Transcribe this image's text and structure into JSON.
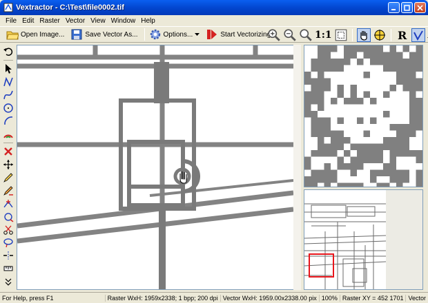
{
  "window": {
    "title": "Vextractor - C:\\Test\\file0002.tif"
  },
  "menu": {
    "items": [
      "File",
      "Edit",
      "Raster",
      "Vector",
      "View",
      "Window",
      "Help"
    ]
  },
  "toolbar": {
    "open_label": "Open Image...",
    "save_label": "Save Vector As...",
    "options_label": "Options...",
    "start_label": "Start Vectorizing",
    "zoom_one_to_one": "1:1",
    "mode_r_label": "R"
  },
  "status": {
    "help": "For Help, press F1",
    "raster": "Raster WxH: 1959x2338; 1 bpp; 200 dpi",
    "vector": "Vector WxH: 1959.00x2338.00 pix",
    "zoom": "100%",
    "raster_xy": "Raster XY =   452 1701",
    "mode": "Vector"
  },
  "colors": {
    "accent": "#0a5ff0",
    "select_box": "#e8151b",
    "raster_gray": "#808080"
  },
  "icons": [
    "app-icon",
    "minimize-icon",
    "maximize-icon",
    "close-icon",
    "open-folder-icon",
    "save-icon",
    "gear-icon",
    "dropdown-icon",
    "start-vectorize-icon",
    "zoom-in-icon",
    "zoom-out-icon",
    "zoom-fit-icon",
    "zoom-window-icon",
    "hand-icon",
    "crosshair-icon",
    "raster-mode-icon",
    "vector-mode-icon"
  ]
}
